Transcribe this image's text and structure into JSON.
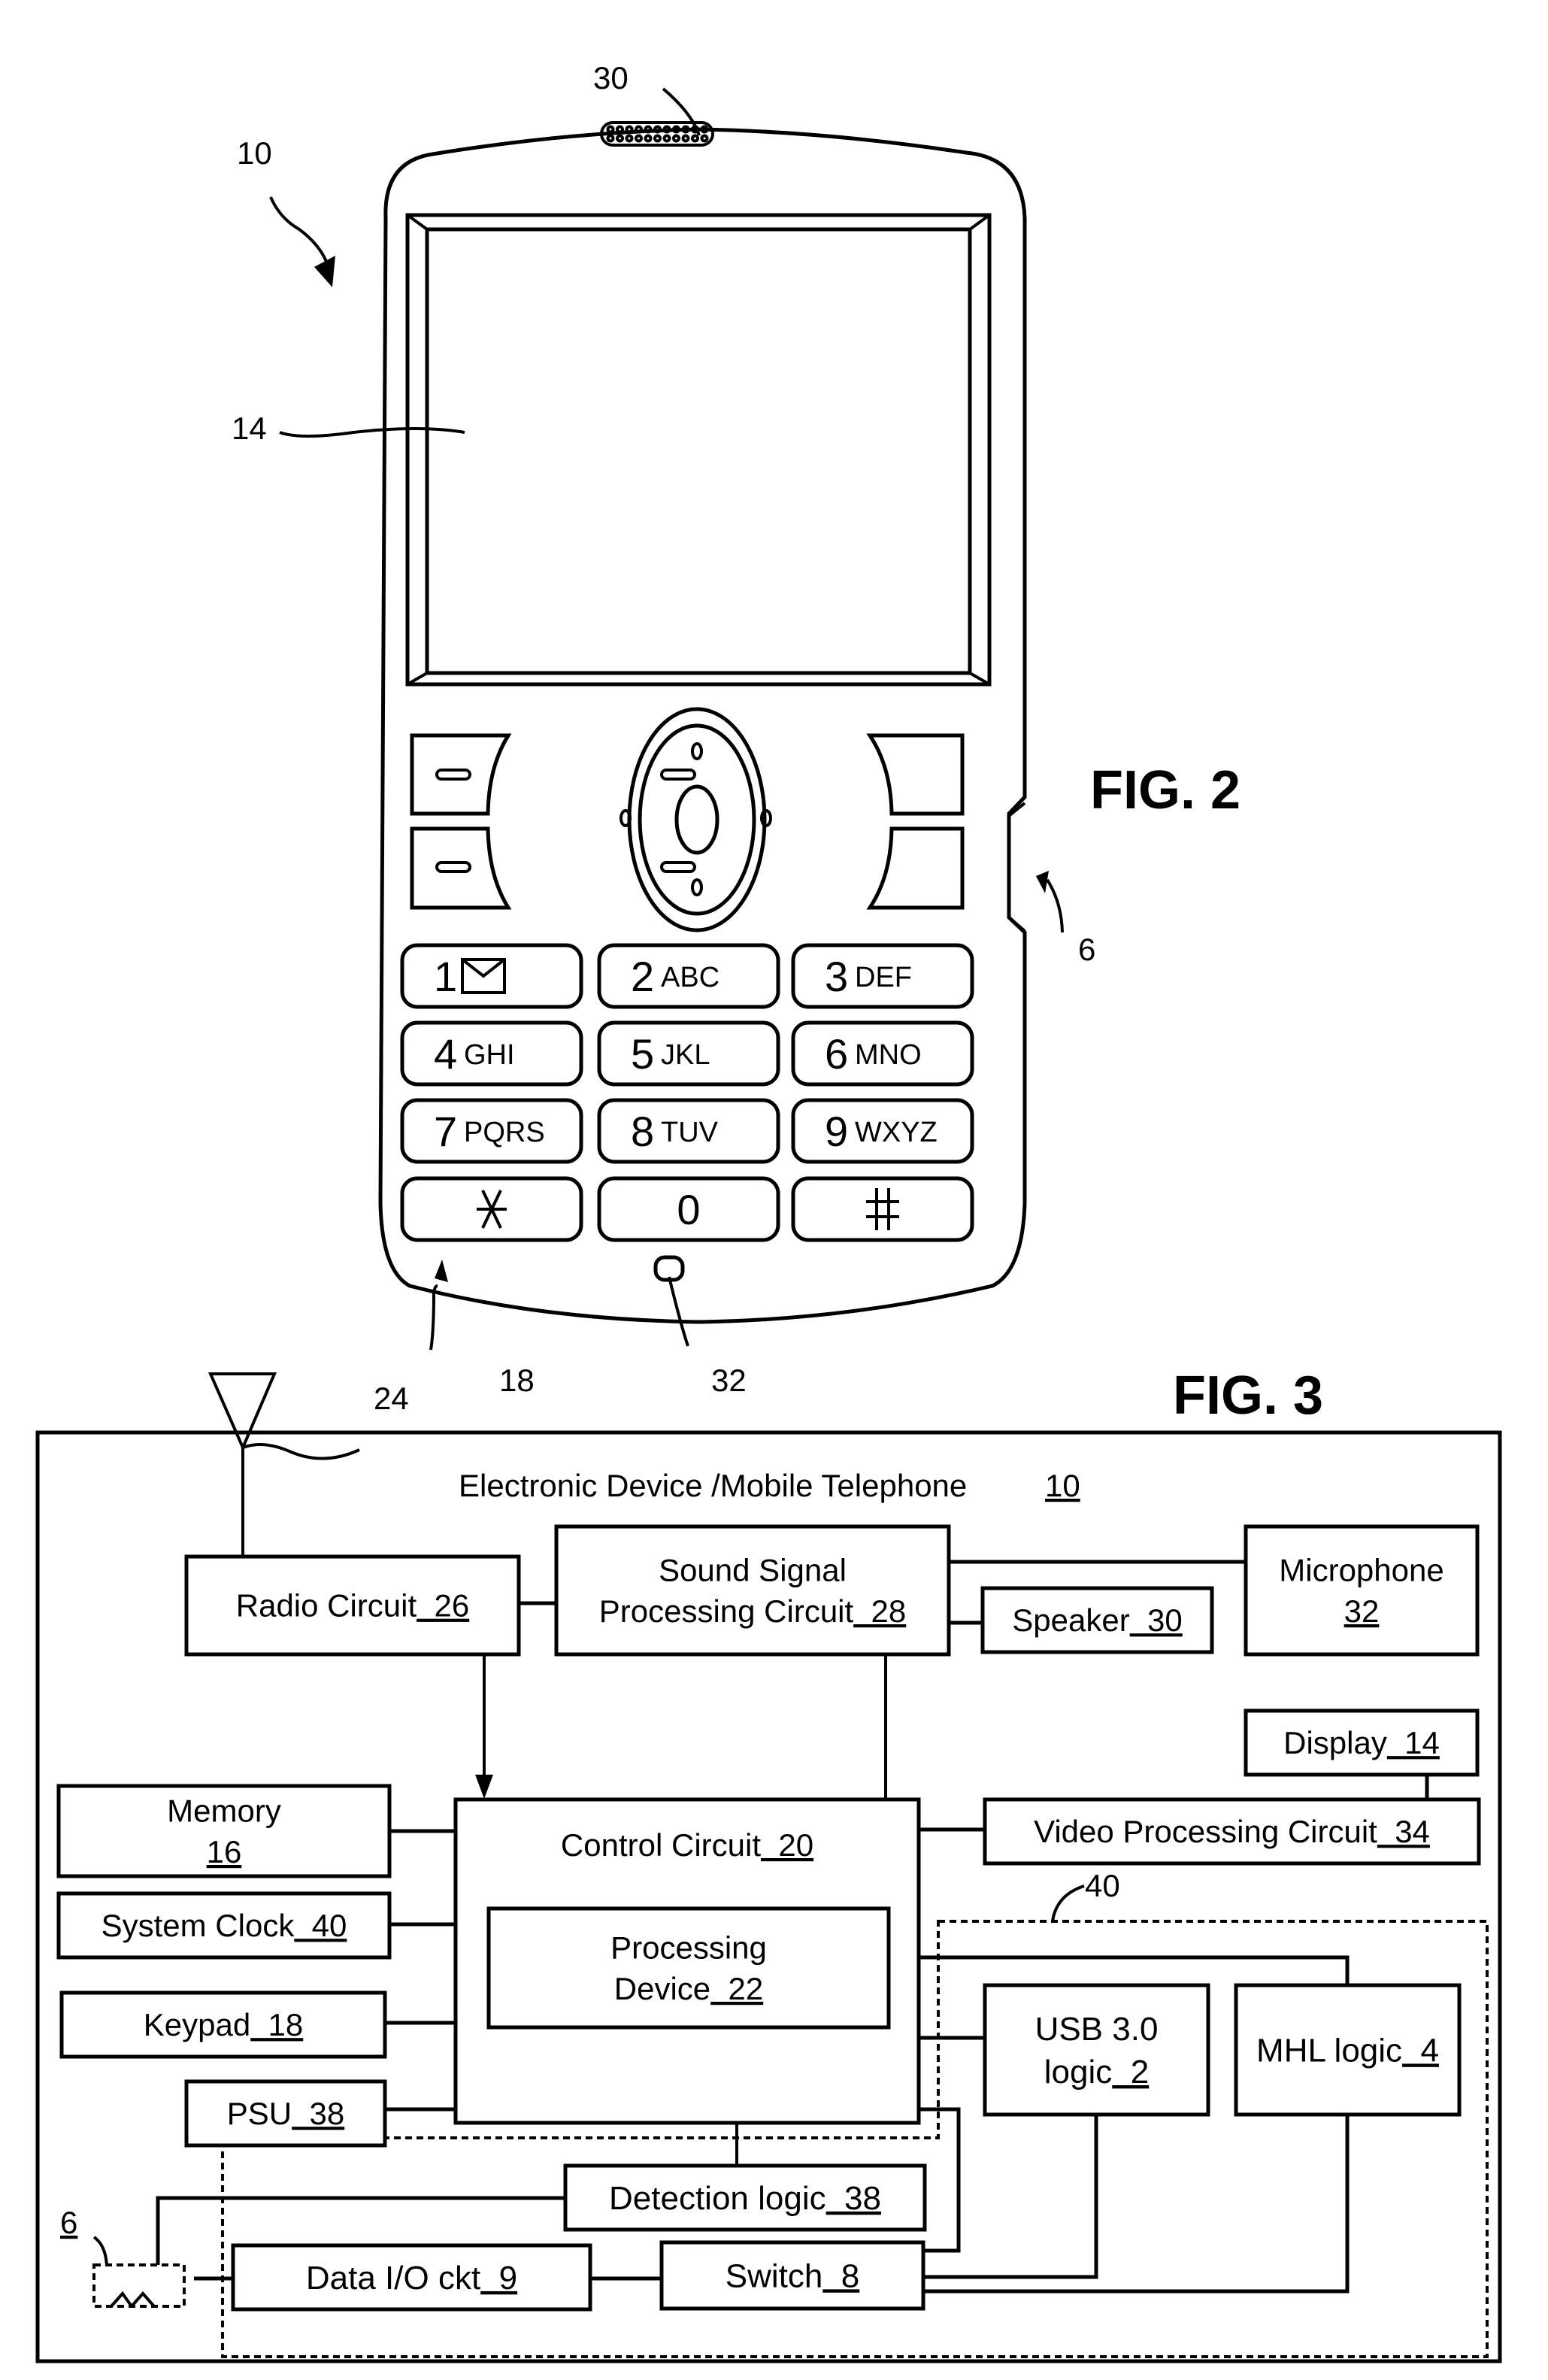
{
  "fig2": {
    "title": "FIG. 2",
    "refs": {
      "device": "10",
      "speaker": "30",
      "display": "14",
      "connector": "6",
      "keypad": "18",
      "microphone": "32"
    },
    "keys": [
      {
        "digit": "1",
        "letters": "",
        "icon": "envelope-icon"
      },
      {
        "digit": "2",
        "letters": "ABC"
      },
      {
        "digit": "3",
        "letters": "DEF"
      },
      {
        "digit": "4",
        "letters": "GHI"
      },
      {
        "digit": "5",
        "letters": "JKL"
      },
      {
        "digit": "6",
        "letters": "MNO"
      },
      {
        "digit": "7",
        "letters": "PQRS"
      },
      {
        "digit": "8",
        "letters": "TUV"
      },
      {
        "digit": "9",
        "letters": "WXYZ"
      },
      {
        "digit": "",
        "letters": "",
        "icon": "asterisk-icon"
      },
      {
        "digit": "0",
        "letters": ""
      },
      {
        "digit": "",
        "letters": "",
        "icon": "hash-icon"
      }
    ]
  },
  "fig3": {
    "title": "FIG. 3",
    "container": {
      "label": "Electronic Device /Mobile Telephone",
      "ref": "10"
    },
    "antenna_ref": "24",
    "blocks": {
      "radio": {
        "lines": [
          "Radio Circuit"
        ],
        "ref": "26"
      },
      "sound": {
        "lines": [
          "Sound Signal",
          "Processing Circuit"
        ],
        "ref": "28"
      },
      "speaker": {
        "lines": [
          "Speaker"
        ],
        "ref": "30"
      },
      "microphone": {
        "lines": [
          "Microphone"
        ],
        "ref": "32"
      },
      "display": {
        "lines": [
          "Display"
        ],
        "ref": "14"
      },
      "video": {
        "lines": [
          "Video Processing Circuit"
        ],
        "ref": "34"
      },
      "memory": {
        "lines": [
          "Memory"
        ],
        "ref": "16"
      },
      "clock": {
        "lines": [
          "System Clock"
        ],
        "ref": "40"
      },
      "keypad": {
        "lines": [
          "Keypad"
        ],
        "ref": "18"
      },
      "psu": {
        "lines": [
          "PSU"
        ],
        "ref": "38"
      },
      "control": {
        "lines": [
          "Control Circuit"
        ],
        "ref": "20"
      },
      "processing": {
        "lines": [
          "Processing",
          "Device"
        ],
        "ref": "22"
      },
      "usb": {
        "lines": [
          "USB 3.0",
          "logic"
        ],
        "ref": "2"
      },
      "mhl": {
        "lines": [
          "MHL logic"
        ],
        "ref": "4"
      },
      "detection": {
        "lines": [
          "Detection logic"
        ],
        "ref": "38"
      },
      "dataio": {
        "lines": [
          "Data I/O ckt"
        ],
        "ref": "9"
      },
      "switch": {
        "lines": [
          "Switch"
        ],
        "ref": "8"
      }
    },
    "group_ref": "40",
    "connector_ref": "6"
  }
}
